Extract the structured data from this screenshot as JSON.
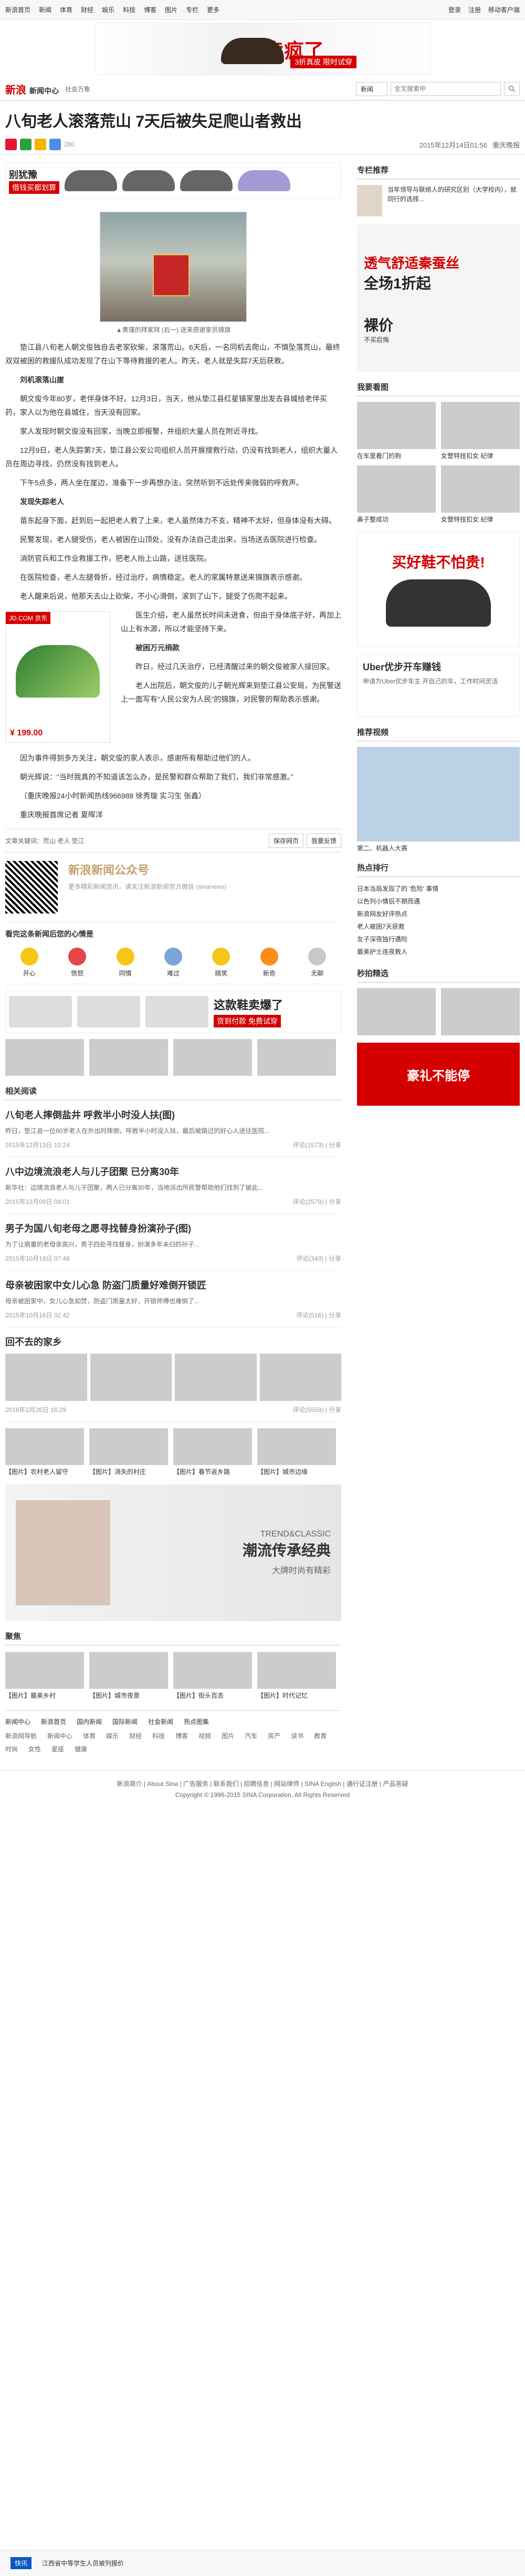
{
  "topbar": {
    "links": [
      "新浪首页",
      "新闻",
      "体育",
      "财经",
      "娱乐",
      "科技",
      "博客",
      "图片",
      "专栏",
      "更多"
    ],
    "right": [
      "登录",
      "注册",
      "移动客户端"
    ]
  },
  "top_ad": {
    "title": "卖疯了",
    "sub": "3折真皮 限时试穿"
  },
  "channel": {
    "logo_main": "新浪",
    "logo_sub": "新闻中心",
    "sub": "社会万象",
    "search_select": "新闻",
    "search_placeholder": "全文搜索中"
  },
  "article": {
    "title": "八旬老人滚落荒山 7天后被失足爬山者救出",
    "share_count": "280",
    "date": "2015年12月14日01:56",
    "source": "重庆晚报",
    "adbanner": {
      "t1": "别犹豫",
      "t2": "借钱买都划算"
    },
    "photo_caption": "▲黄瑾的拜家拜 (右一) 送来感谢家员锦旗",
    "paras": [
      "垫江县八旬老人朝文俊独自去老家砍柴，滚落荒山。6天后，一名同机去爬山，不慎坠落荒山，最终双双被困的救援队成功发现了在山下等待救援的老人。昨天，老人就是失踪7天后获救。",
      "刘机滚落山崖",
      "朝文俊今年80岁，老伴身体不好。12月3日，当天，他从垫江县红星镇家里出发去县城给老伴买药，家人以为他在县城住，当天没有回家。",
      "家人发现时朝文俊没有回家，当晚立即报警，并组织大量人员在附近寻找。",
      "12月9日，老人失踪第7天，垫江县公安公司组织人员开展搜救行动，仍没有找到老人，组织大量人员在周边寻找，仍然没有找到老人。",
      "下午5点多，两人坐在崖边，准备下一步再想办法，突然听到不远处传来微弱的呼救声。",
      "发现失踪老人",
      "苗东起身下面，赶到后一起把老人救了上来，老人虽然体力不支，精神不太好，但身体没有大碍。",
      "民警发现，老人腿受伤，老人被困在山顶处，没有办法自己走出来，当场送去医院进行检查。",
      "消防官兵和工作业救援工作，把老人抬上山路，送往医院。",
      "在医院检查，老人左腿骨折，经过治疗，病情稳定。老人的家属特意送来锦旗表示感谢。",
      "老人醒来后说，他那天去山上砍柴，不小心滑倒，滚到了山下，腿受了伤爬不起来。"
    ],
    "product": {
      "badge": "JD.COM 京东",
      "price": "¥ 199.00"
    },
    "paras2": [
      "医生介绍，老人虽然长时间未进食，但由于身体底子好，再加上山上有水源，所以才能坚持下来。",
      "被困万元捐款",
      "昨日，经过几天治疗，已经清醒过来的朝文俊被家人接回家。",
      "老人出院后，朝文俊的儿子朝光辉来到垫江县公安局，为民警送上一面写有“人民公安为人民”的锦旗，对民警的帮助表示感谢。",
      "因为事件得到多方关注，朝文俊的家人表示，感谢所有帮助过他们的人。",
      "朝光辉说：“当时我真的不知道该怎么办，是民警和群众帮助了我们，我们非常感激。”",
      "（重庆晚报24小时新闻热线966988 徐秀璇 实习生 张鑫）",
      "重庆晚报首席记者 夏晖洋"
    ],
    "keywords": "文章关键词：荒山 老人 垫江",
    "tool_buttons": [
      "保存网页",
      "我要反馈"
    ]
  },
  "wechat": {
    "title": "新浪新闻公众号",
    "desc": "更多精彩新闻资讯，请关注新浪新闻官方微信 (sinanews)"
  },
  "mood": {
    "title": "看完这条新闻后您的心情是",
    "items": [
      "开心",
      "愤怒",
      "同情",
      "难过",
      "搞笑",
      "新奇",
      "无聊"
    ]
  },
  "adstrip": {
    "t1": "这款鞋卖爆了",
    "t2": "货到付款 免费试穿"
  },
  "related": {
    "title": "相关阅读",
    "items": [
      {
        "title": "八旬老人摔倒盐井 呼救半小时没人扶(图)",
        "sum": "昨日，垫江县一位80岁老人在外出时摔倒，呼救半小时没人扶，最后被路过的好心人送往医院...",
        "left": "2015年12月13日 10:24",
        "right": "评论(1573) | 分享"
      },
      {
        "title": "八中边境流浪老人与儿子团聚 已分离30年",
        "sum": "新华社：边境流浪老人与儿子团聚，两人已分离30年，当地派出所民警帮助他们找到了彼此...",
        "left": "2015年12月09日 09:01",
        "right": "评论(2579) | 分享"
      },
      {
        "title": "男子为国八旬老母之愿寻找替身扮演孙子(图)",
        "sum": "为了让病重的老母亲高兴，男子四处寻找替身，扮演多年未归的孙子...",
        "left": "2015年10月18日 07:48",
        "right": "评论(343) | 分享"
      },
      {
        "title": "母亲被困家中女儿心急 防盗门质量好难倒开锁匠",
        "sum": "母亲被困家中，女儿心急如焚，防盗门质量太好，开锁师傅也难倒了...",
        "left": "2015年10月16日 02:42",
        "right": "评论(516) | 分享"
      }
    ]
  },
  "hometown": {
    "title": "回不去的家乡",
    "left": "2016年2月26日 16:29",
    "right": "评论(5559) | 分享",
    "cells": [
      "【图片】农村老人留守",
      "【图片】消失的村庄",
      "【图片】春节返乡路",
      "【图片】城市边缘"
    ]
  },
  "bigad": {
    "title": "TREND&CLASSIC",
    "subtitle": "潮流传承经典",
    "desc": "大牌时尚有精彩"
  },
  "gallery": {
    "title": "聚焦",
    "cells": [
      "【图片】最美乡村",
      "【图片】城市夜景",
      "【图片】街头百态",
      "【图片】时代记忆"
    ]
  },
  "footer": {
    "tabs": [
      "新闻中心",
      "新浪首页",
      "国内新闻",
      "国际新闻",
      "社会新闻",
      "热点图集"
    ],
    "links": [
      "新浪网导航",
      "新闻中心",
      "体育",
      "娱乐",
      "财经",
      "科技",
      "博客",
      "视频",
      "图片",
      "汽车",
      "房产",
      "读书",
      "教育",
      "时尚",
      "女性",
      "星座",
      "健康"
    ],
    "about": "新浪简介 | About Sina | 广告服务 | 联系我们 | 招聘信息 | 网站律师 | SINA English | 通行证注册 | 产品答疑",
    "copyright": "Copyright © 1996-2015 SINA Corporation, All Rights Reserved"
  },
  "bottombar": {
    "tag": "快讯",
    "text": "江西省中等学生人员被列报价"
  },
  "side": {
    "ad_title": "透气舒适秦蚕丝",
    "ad_sub": "全场1折起",
    "ad2_title": "裸价",
    "ad2_sub": "不买后悔",
    "rec_title": "专栏推荐",
    "rec_text": "当年领导与联络人的研究区别（大学校内），就同行的选择...",
    "pics_title": "我要看图",
    "pics": [
      "在车里看门的狗",
      "女警特技扣女 纪律",
      "鼻子整成功",
      "女警特技扣女 纪律"
    ],
    "ad3": "买好鞋不怕贵!",
    "uber_title": "Uber优步开车赚钱",
    "uber_sub": "申请为Uber优步车主 开自己的车，工作时间灵活",
    "hot_title": "热点排行",
    "hot": [
      "日本当局发现了的 '危险' 事情",
      "以色列小情侣不期而遇",
      "新浪网友好评热点",
      "老人被困7天获救",
      "女子深夜独行遇险",
      "最美护士连夜救人"
    ],
    "video_title": "推荐视频",
    "video_caption": "第二、机器人大赛",
    "fun_title": "秒拍精选",
    "ad_bottom": "豪礼不能停"
  }
}
